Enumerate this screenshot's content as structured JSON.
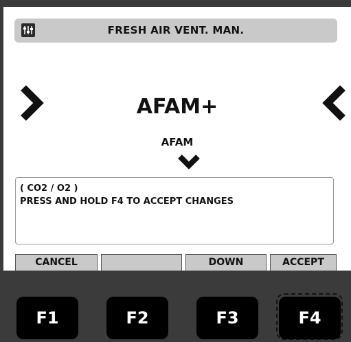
{
  "header": {
    "title": "FRESH AIR VENT. MAN.",
    "icon": "menu-settings-icon"
  },
  "selector": {
    "current_value": "AFAM+",
    "next_value": "AFAM"
  },
  "info": {
    "line1": "( CO2 / O2 )",
    "line2": "PRESS AND HOLD F4 TO ACCEPT CHANGES"
  },
  "softkeys": {
    "f1": "CANCEL",
    "f2": "",
    "f3": "DOWN",
    "f4": "ACCEPT"
  },
  "function_keys": {
    "f1": "F1",
    "f2": "F2",
    "f3": "F3",
    "f4": "F4"
  },
  "colors": {
    "background": "#3b3b3b",
    "title_bar": "#c9c9c9",
    "screen": "#ffffff",
    "key": "#000000"
  }
}
